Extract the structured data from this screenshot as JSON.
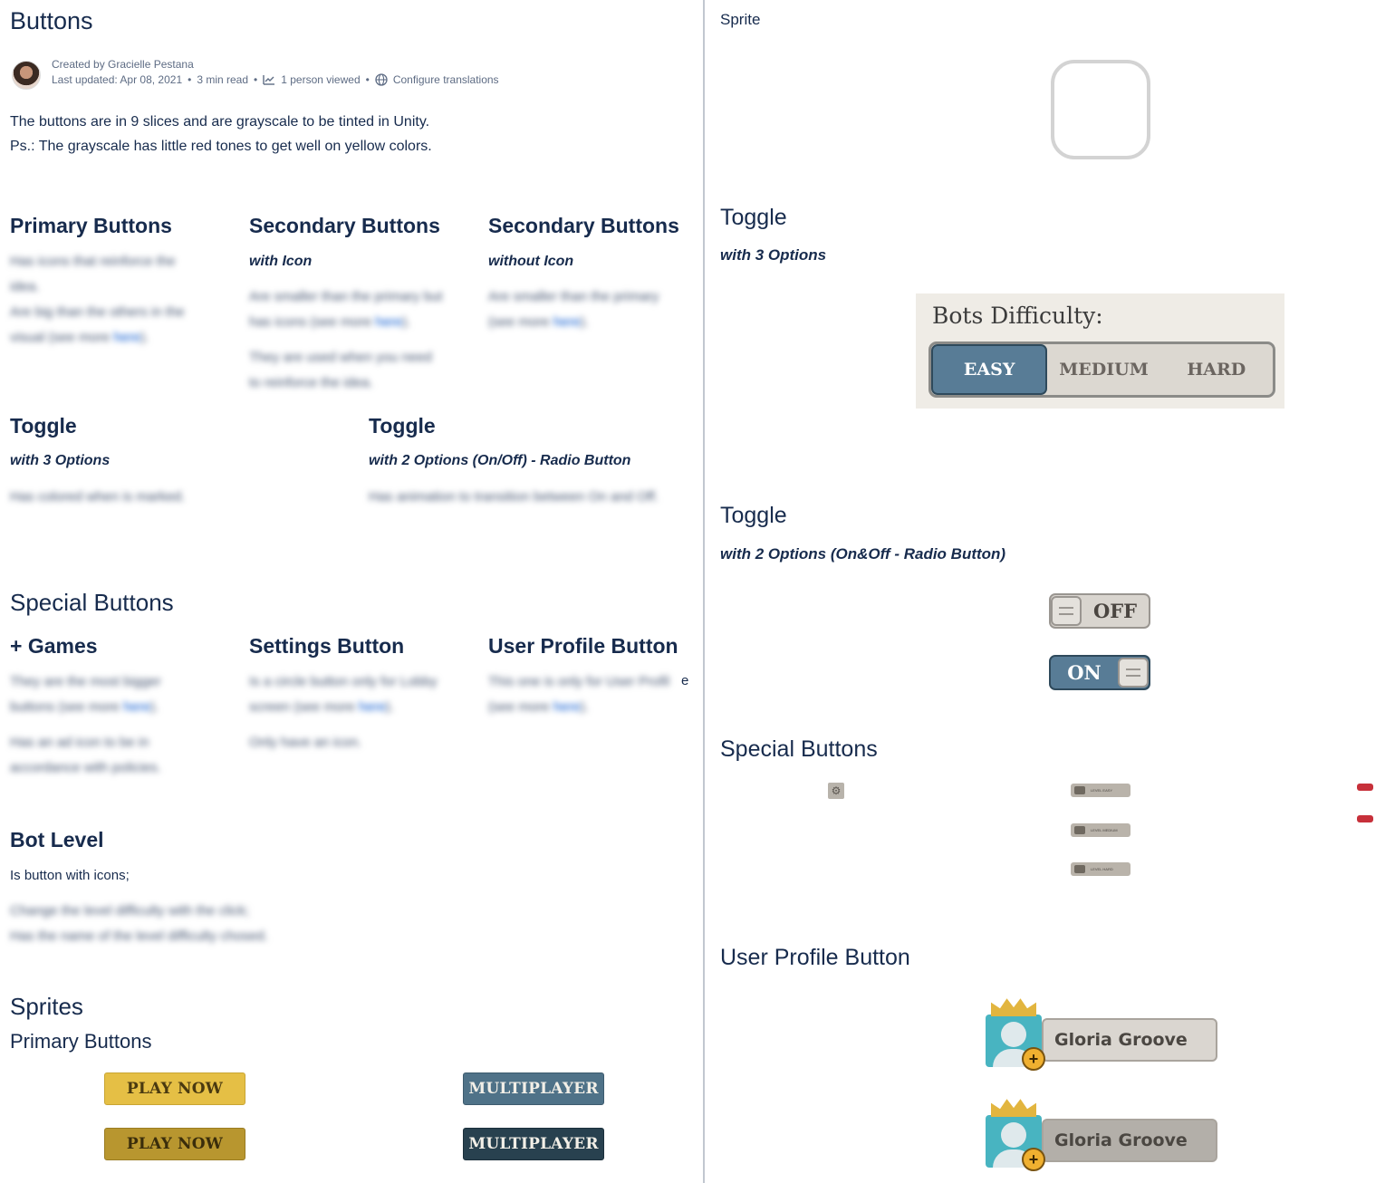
{
  "page": {
    "title": "Buttons",
    "created_by": "Created by Gracielle Pestana",
    "last_updated": "Last updated: Apr 08, 2021",
    "read_time": "3 min read",
    "viewed": "1 person viewed",
    "translations": "Configure translations",
    "intro_line1": "The buttons are in 9 slices and are grayscale to be tinted in Unity.",
    "intro_line2": "Ps.: The grayscale has little red tones to get well on yellow colors."
  },
  "sections": {
    "primary": {
      "title": "Primary Buttons",
      "line1": "Has icons that reinforce the",
      "line2": "idea.",
      "line3": "Are big than the others in the",
      "line4": "visual (see more ",
      "link": "here",
      "line4_end": ")."
    },
    "secondary_icon": {
      "title": "Secondary Buttons",
      "sub": "with Icon",
      "line1": "Are smaller than the primary but",
      "line2": "has icons (see more ",
      "link": "here",
      "line2_end": ").",
      "line3": "They are used when you need",
      "line4": "to reinforce the idea."
    },
    "secondary_noicon": {
      "title": "Secondary Buttons",
      "sub": "without Icon",
      "line1": "Are smaller than the primary",
      "line2": "(see more ",
      "link": "here",
      "line2_end": ")."
    },
    "toggle3": {
      "title": "Toggle",
      "sub": "with 3 Options",
      "line1": "Has colored when is marked."
    },
    "toggle2": {
      "title": "Toggle",
      "sub": "with 2 Options (On/Off) - Radio Button",
      "line1": "Has animation to transition between On and Off."
    },
    "special": {
      "title": "Special Buttons"
    },
    "games": {
      "title": "+ Games",
      "line1": "They are the most bigger",
      "line2": "buttons (see more ",
      "link": "here",
      "line2_end": ").",
      "line3": "Has an ad icon to be in",
      "line4": "accordance with policies."
    },
    "settings": {
      "title": "Settings Button",
      "line1": "Is a circle button only for Lobby",
      "line2": "screen (see more ",
      "link": "here",
      "line2_end": ").",
      "line3": "Only have an icon."
    },
    "userprofile": {
      "title": "User Profile Button",
      "line1": "This one is only for User Profil",
      "tail": "e",
      "line2": "(see more ",
      "link": "here",
      "line2_end": ")."
    },
    "botlevel": {
      "title": "Bot Level",
      "line0": "Is button with icons;",
      "line1": "Change the level difficulty with the click;",
      "line2": "Has the name of the level difficulty chosed."
    },
    "sprites": {
      "title": "Sprites",
      "sub": "Primary Buttons"
    }
  },
  "sprite_buttons": {
    "play_now_1": "PLAY NOW",
    "play_now_2": "PLAY NOW",
    "multiplayer_1": "MULTIPLAYER",
    "multiplayer_2": "MULTIPLAYER"
  },
  "right": {
    "sprite_label": "Sprite",
    "toggle3_title": "Toggle",
    "toggle3_sub": "with 3 Options",
    "bots_title": "Bots Difficulty:",
    "bots_options": [
      "EASY",
      "MEDIUM",
      "HARD"
    ],
    "bots_selected": "EASY",
    "toggle2_title": "Toggle",
    "toggle2_sub": "with 2 Options (On&Off - Radio Button)",
    "off_label": "OFF",
    "on_label": "ON",
    "special_title": "Special Buttons",
    "level_chip_1": "LEVEL EASY",
    "level_chip_2": "LEVEL MEDIUM",
    "level_chip_3": "LEVEL HARD",
    "profile_title": "User Profile Button",
    "profile_name_1": "Gloria Groove",
    "profile_name_2": "Gloria Groove"
  },
  "colors": {
    "text": "#172b4d",
    "link": "#0052cc",
    "toggle_active": "#587c96",
    "yellow_button": "#e5bf45",
    "yellow_button_pressed": "#b8962f",
    "blue_button": "#4f7288",
    "blue_button_pressed": "#28414f",
    "ad_red": "#c7303a",
    "profile_teal": "#48b4c1"
  },
  "icons": {
    "history": "chart-line-icon",
    "globe": "globe-icon",
    "gear": "gear-icon",
    "plus": "plus-icon",
    "crown": "crown-icon"
  }
}
